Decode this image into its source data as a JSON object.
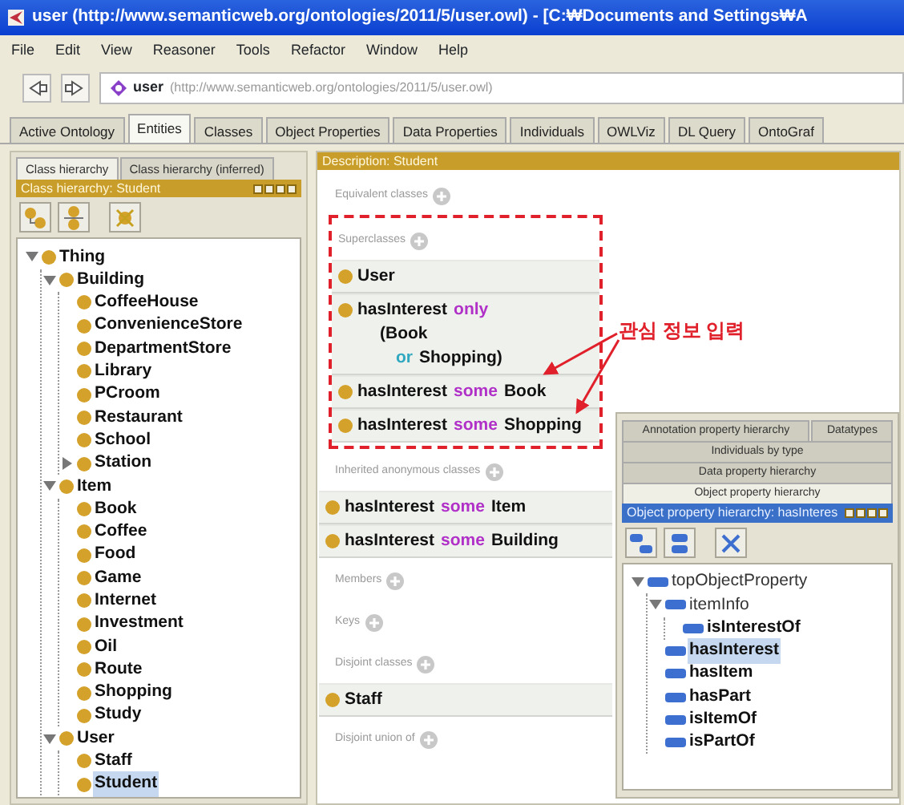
{
  "window": {
    "title": "user (http://www.semanticweb.org/ontologies/2011/5/user.owl) - [C:₩Documents and Settings₩A"
  },
  "menu": [
    "File",
    "Edit",
    "View",
    "Reasoner",
    "Tools",
    "Refactor",
    "Window",
    "Help"
  ],
  "address": {
    "name": "user",
    "iri": "(http://www.semanticweb.org/ontologies/2011/5/user.owl)"
  },
  "tabs": [
    {
      "label": "Active Ontology",
      "selected": false
    },
    {
      "label": "Entities",
      "selected": true
    },
    {
      "label": "Classes",
      "selected": false
    },
    {
      "label": "Object Properties",
      "selected": false
    },
    {
      "label": "Data Properties",
      "selected": false
    },
    {
      "label": "Individuals",
      "selected": false
    },
    {
      "label": "OWLViz",
      "selected": false
    },
    {
      "label": "DL Query",
      "selected": false
    },
    {
      "label": "OntoGraf",
      "selected": false
    }
  ],
  "class_panel": {
    "tabs": [
      {
        "label": "Class hierarchy",
        "selected": true
      },
      {
        "label": "Class hierarchy (inferred)",
        "selected": false
      }
    ],
    "header": "Class hierarchy: Student",
    "tree": [
      {
        "label": "Thing",
        "expanded": true,
        "selected": false,
        "children": [
          {
            "label": "Building",
            "expanded": true,
            "selected": false,
            "children": [
              {
                "label": "CoffeeHouse",
                "selected": false
              },
              {
                "label": "ConvenienceStore",
                "selected": false
              },
              {
                "label": "DepartmentStore",
                "selected": false
              },
              {
                "label": "Library",
                "selected": false
              },
              {
                "label": "PCroom",
                "selected": false
              },
              {
                "label": "Restaurant",
                "selected": false
              },
              {
                "label": "School",
                "selected": false
              },
              {
                "label": "Station",
                "expanded": false,
                "selected": false
              }
            ]
          },
          {
            "label": "Item",
            "expanded": true,
            "selected": false,
            "children": [
              {
                "label": "Book",
                "selected": false
              },
              {
                "label": "Coffee",
                "selected": false
              },
              {
                "label": "Food",
                "selected": false
              },
              {
                "label": "Game",
                "selected": false
              },
              {
                "label": "Internet",
                "selected": false
              },
              {
                "label": "Investment",
                "selected": false
              },
              {
                "label": "Oil",
                "selected": false
              },
              {
                "label": "Route",
                "selected": false
              },
              {
                "label": "Shopping",
                "selected": false
              },
              {
                "label": "Study",
                "selected": false
              }
            ]
          },
          {
            "label": "User",
            "expanded": true,
            "selected": false,
            "children": [
              {
                "label": "Staff",
                "selected": false
              },
              {
                "label": "Student",
                "selected": true
              }
            ]
          }
        ]
      }
    ]
  },
  "description": {
    "header": "Description: Student",
    "sections": [
      {
        "label": "Equivalent classes"
      },
      {
        "label": "Superclasses",
        "highlighted": true,
        "items": [
          {
            "lines": [
              {
                "kind": "head",
                "parts": [
                  {
                    "kind": "name",
                    "text": "User"
                  }
                ]
              }
            ]
          },
          {
            "lines": [
              {
                "kind": "head",
                "parts": [
                  {
                    "kind": "name",
                    "text": "hasInterest"
                  },
                  {
                    "kind": "keyword",
                    "text": "only"
                  }
                ]
              },
              {
                "kind": "operand",
                "parts": [
                  {
                    "kind": "name",
                    "text": "(Book"
                  }
                ]
              },
              {
                "kind": "continuation",
                "parts": [
                  {
                    "kind": "connective",
                    "text": "or"
                  },
                  {
                    "kind": "name",
                    "text": "Shopping)"
                  }
                ]
              }
            ]
          },
          {
            "lines": [
              {
                "kind": "head",
                "parts": [
                  {
                    "kind": "name",
                    "text": "hasInterest"
                  },
                  {
                    "kind": "keyword",
                    "text": "some"
                  },
                  {
                    "kind": "name",
                    "text": "Book"
                  }
                ]
              }
            ]
          },
          {
            "lines": [
              {
                "kind": "head",
                "parts": [
                  {
                    "kind": "name",
                    "text": "hasInterest"
                  },
                  {
                    "kind": "keyword",
                    "text": "some"
                  },
                  {
                    "kind": "name",
                    "text": "Shopping"
                  }
                ]
              }
            ]
          }
        ]
      },
      {
        "label": "Inherited anonymous classes",
        "items": [
          {
            "lines": [
              {
                "kind": "head",
                "parts": [
                  {
                    "kind": "name",
                    "text": "hasInterest"
                  },
                  {
                    "kind": "keyword",
                    "text": "some"
                  },
                  {
                    "kind": "name",
                    "text": "Item"
                  }
                ]
              }
            ]
          },
          {
            "lines": [
              {
                "kind": "head",
                "parts": [
                  {
                    "kind": "name",
                    "text": "hasInterest"
                  },
                  {
                    "kind": "keyword",
                    "text": "some"
                  },
                  {
                    "kind": "name",
                    "text": "Building"
                  }
                ]
              }
            ]
          }
        ]
      },
      {
        "label": "Members"
      },
      {
        "label": "Keys"
      },
      {
        "label": "Disjoint classes",
        "items": [
          {
            "lines": [
              {
                "kind": "head",
                "parts": [
                  {
                    "kind": "name",
                    "text": "Staff"
                  }
                ]
              }
            ]
          }
        ]
      },
      {
        "label": "Disjoint union of"
      }
    ]
  },
  "annotation": {
    "text": "관심 정보 입력"
  },
  "property_panel": {
    "tab_rows": [
      [
        {
          "label": "Annotation property hierarchy",
          "selected": false
        },
        {
          "label": "Datatypes",
          "selected": false
        }
      ],
      [
        {
          "label": "Individuals by type",
          "selected": false
        }
      ],
      [
        {
          "label": "Data property hierarchy",
          "selected": false
        }
      ],
      [
        {
          "label": "Object property hierarchy",
          "selected": true
        }
      ]
    ],
    "header": "Object property hierarchy: hasInteres",
    "tree": [
      {
        "label": "topObjectProperty",
        "expanded": true,
        "selected": false,
        "children": [
          {
            "label": "itemInfo",
            "expanded": true,
            "selected": false,
            "children": [
              {
                "label": "isInterestOf",
                "selected": false
              }
            ]
          },
          {
            "label": "hasInterest",
            "selected": true
          },
          {
            "label": "hasItem",
            "selected": false
          },
          {
            "label": "hasPart",
            "selected": false
          },
          {
            "label": "isItemOf",
            "selected": false
          },
          {
            "label": "isPartOf",
            "selected": false
          }
        ]
      }
    ]
  }
}
